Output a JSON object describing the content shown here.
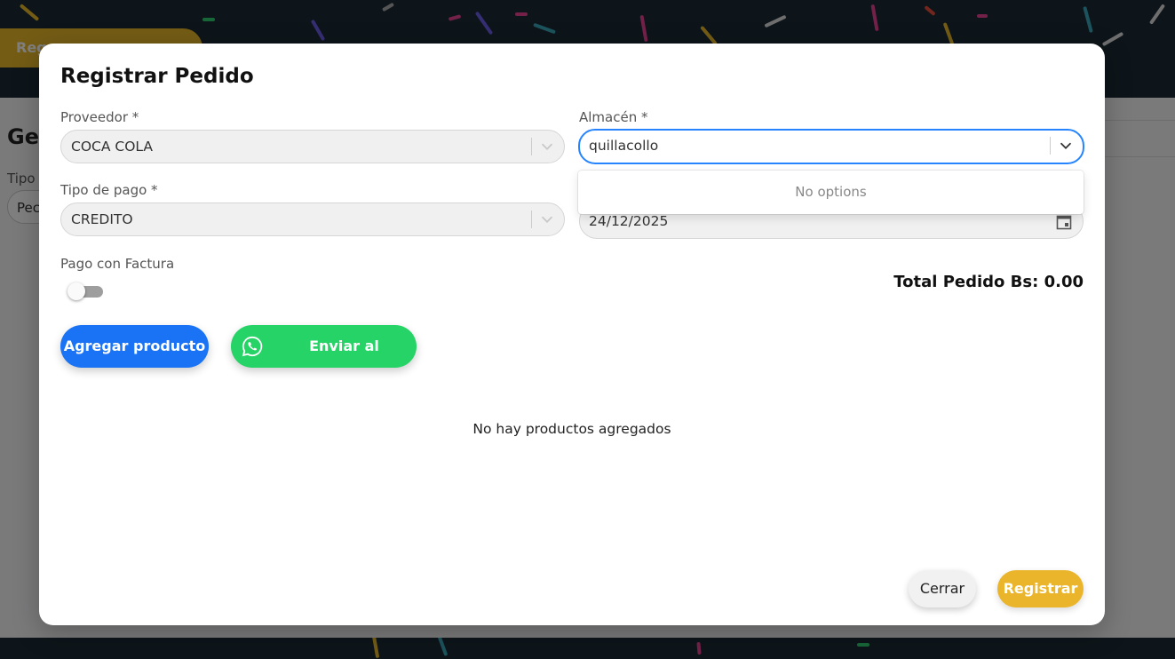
{
  "background": {
    "top_button_label": "Reg",
    "page_title": "Ges",
    "filter_label": "Tipo",
    "filter_value": "Pec"
  },
  "modal": {
    "title": "Registrar Pedido",
    "proveedor": {
      "label": "Proveedor *",
      "value": "COCA COLA"
    },
    "almacen": {
      "label": "Almacén *",
      "value": "quillacollo",
      "dropdown_message": "No options"
    },
    "tipo_pago": {
      "label": "Tipo de pago *",
      "value": "CREDITO"
    },
    "fecha": {
      "value": "24/12/2025"
    },
    "factura": {
      "label": "Pago con Factura",
      "enabled": false
    },
    "total_label": "Total Pedido Bs: 0.00",
    "add_product_label": "Agregar producto",
    "send_supplier_label": "Enviar al proveedor",
    "empty_message": "No hay productos agregados",
    "close_label": "Cerrar",
    "register_label": "Registrar"
  },
  "colors": {
    "primary_blue": "#1a73f5",
    "whatsapp_green": "#25d366",
    "accent_yellow": "#eab52a",
    "focus_border": "#2684ff"
  }
}
